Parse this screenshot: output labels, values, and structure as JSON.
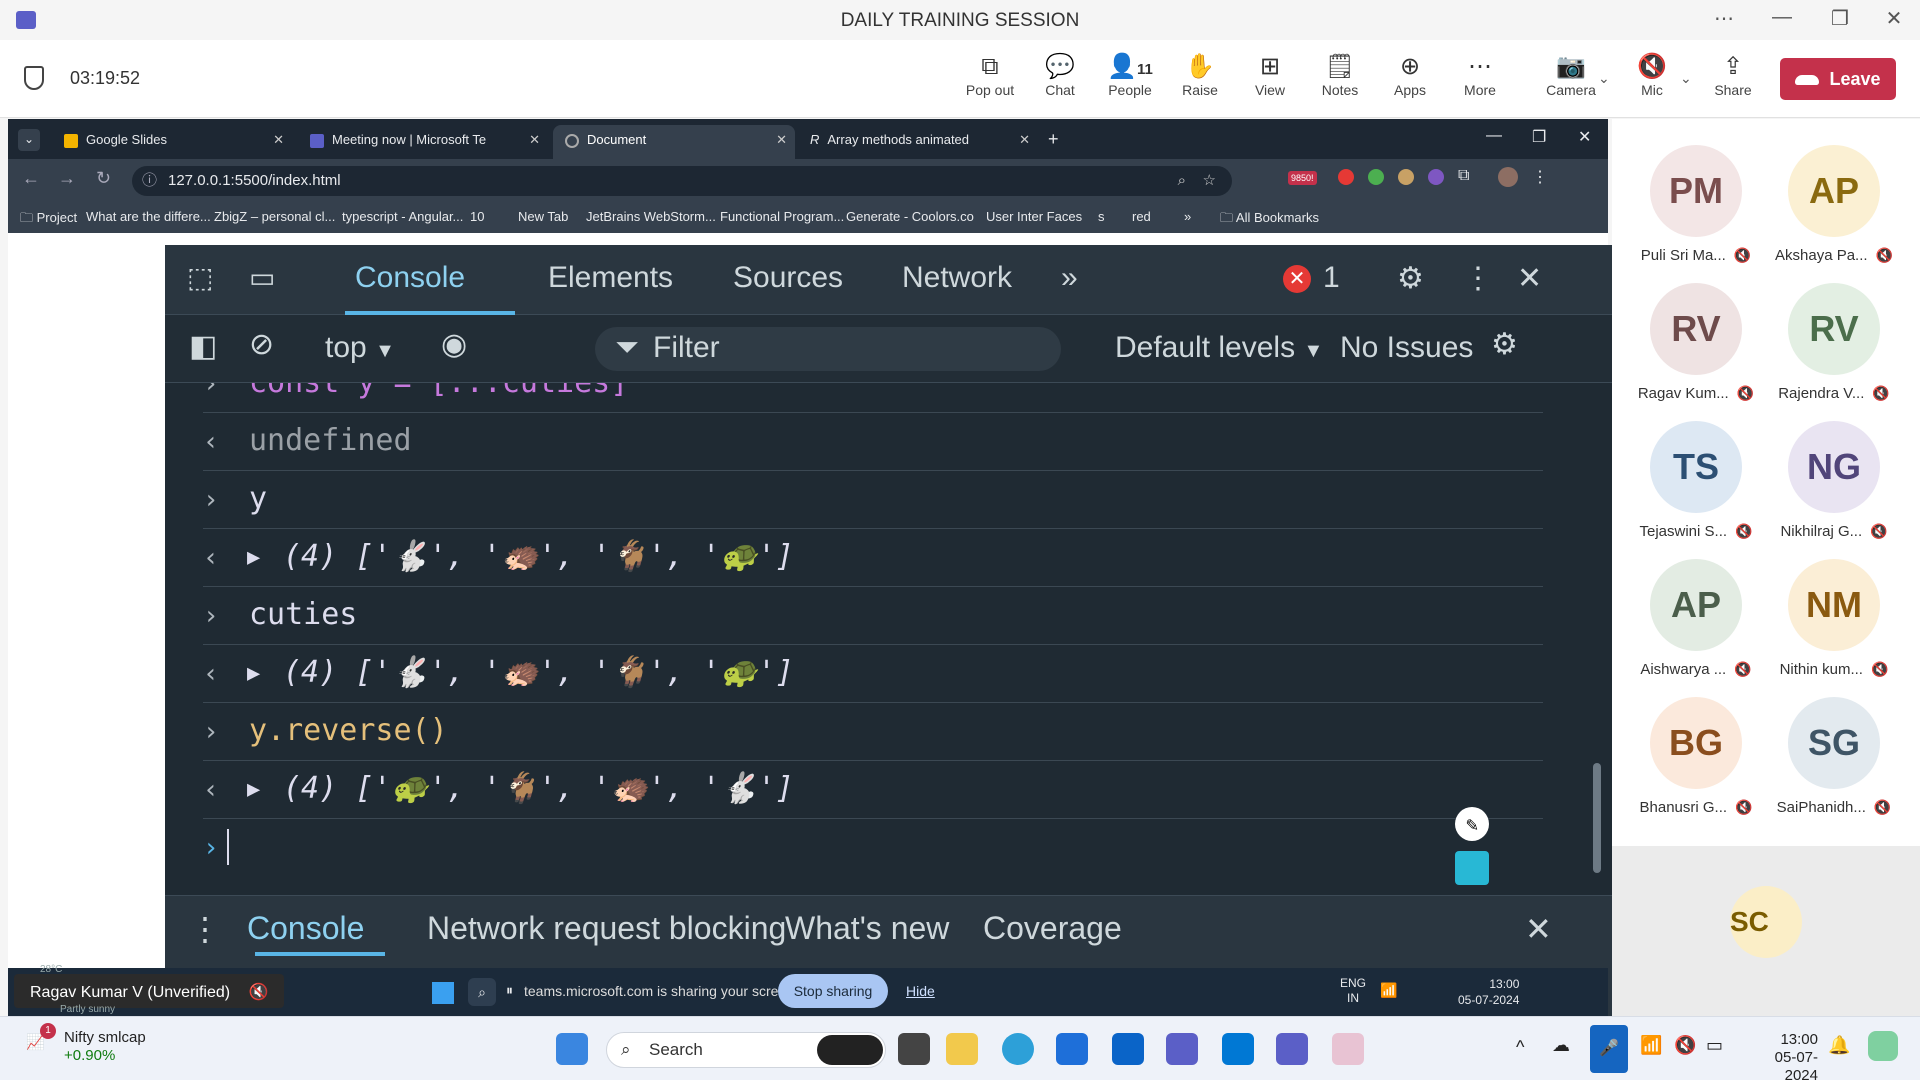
{
  "window": {
    "title": "DAILY TRAINING SESSION"
  },
  "meeting": {
    "timer": "03:19:52",
    "buttons": [
      {
        "label": "Pop out",
        "icon": "pop-out-icon"
      },
      {
        "label": "Chat",
        "icon": "chat-icon"
      },
      {
        "label": "People",
        "icon": "people-icon",
        "count": "11"
      },
      {
        "label": "Raise",
        "icon": "raise-hand-icon"
      },
      {
        "label": "View",
        "icon": "view-icon"
      },
      {
        "label": "Notes",
        "icon": "notes-icon"
      },
      {
        "label": "Apps",
        "icon": "apps-icon"
      },
      {
        "label": "More",
        "icon": "more-icon"
      },
      {
        "label": "Camera",
        "icon": "camera-off-icon"
      },
      {
        "label": "Mic",
        "icon": "mic-off-icon"
      },
      {
        "label": "Share",
        "icon": "share-icon"
      }
    ],
    "leave_label": "Leave"
  },
  "browser": {
    "tabs": [
      {
        "label": "Google Slides"
      },
      {
        "label": "Meeting now | Microsoft Te"
      },
      {
        "label": "Document"
      },
      {
        "label": "Array methods animated"
      }
    ],
    "url": "127.0.0.1:5500/index.html",
    "extension_badge": "9850!",
    "bookmarks": [
      "Project",
      "What are the differe...",
      "ZbigZ – personal cl...",
      "typescript - Angular...",
      "10",
      "New Tab",
      "JetBrains WebStorm...",
      "Functional Program...",
      "Generate - Coolors.co",
      "User Inter Faces",
      "s",
      "red",
      "All Bookmarks"
    ]
  },
  "devtools": {
    "tabs": [
      "Console",
      "Elements",
      "Sources",
      "Network"
    ],
    "error_count": "1",
    "context": "top",
    "filter_placeholder": "Filter",
    "levels": "Default levels",
    "issues": "No Issues",
    "console_lines": [
      {
        "dir": "in",
        "text": "const y = [...cuties]"
      },
      {
        "dir": "out",
        "text": "undefined"
      },
      {
        "dir": "in",
        "text": "y"
      },
      {
        "dir": "out",
        "text": "(4) ['🐇', '🦔', '🐐', '🐢']"
      },
      {
        "dir": "in",
        "text": "cuties"
      },
      {
        "dir": "out",
        "text": "(4) ['🐇', '🦔', '🐐', '🐢']"
      },
      {
        "dir": "in",
        "text": "y.reverse()"
      },
      {
        "dir": "out",
        "text": "(4) ['🐢', '🐐', '🦔', '🐇']"
      }
    ],
    "drawer_tabs": [
      "Console",
      "Network request blocking",
      "What's new",
      "Coverage"
    ]
  },
  "participants": [
    {
      "initials": "PM",
      "name": "Puli Sri Ma...",
      "bg": "#f3e6e6",
      "fg": "#7a4d4d"
    },
    {
      "initials": "AP",
      "name": "Akshaya Pa...",
      "bg": "#fbf0d3",
      "fg": "#8a6a10"
    },
    {
      "initials": "RV",
      "name": "Ragav Kum...",
      "bg": "#efe3e3",
      "fg": "#6e4b4b"
    },
    {
      "initials": "RV",
      "name": "Rajendra V...",
      "bg": "#e3efe3",
      "fg": "#4b6e4b"
    },
    {
      "initials": "TS",
      "name": "Tejaswini S...",
      "bg": "#dde8f3",
      "fg": "#2c4f73"
    },
    {
      "initials": "NG",
      "name": "Nikhilraj G...",
      "bg": "#e9e4f2",
      "fg": "#51457a"
    },
    {
      "initials": "AP",
      "name": "Aishwarya ...",
      "bg": "#e3ece3",
      "fg": "#4b5e4b"
    },
    {
      "initials": "NM",
      "name": "Nithin kum...",
      "bg": "#fbeed6",
      "fg": "#8a5a10"
    },
    {
      "initials": "BG",
      "name": "Bhanusri G...",
      "bg": "#fbe9dc",
      "fg": "#8a4e1e"
    },
    {
      "initials": "SG",
      "name": "SaiPhanidh...",
      "bg": "#e3eaef",
      "fg": "#3f5566"
    }
  ],
  "self_initials": "SC",
  "share": {
    "presenter": "Ragav Kumar V (Unverified)",
    "message": "teams.microsoft.com is sharing your screen.",
    "stop_label": "Stop sharing",
    "hide_label": "Hide",
    "lang": "ENG",
    "lang_region": "IN",
    "time": "13:00",
    "date": "05-07-2024",
    "weather_temp": "28°C",
    "weather_text": "Partly sunny"
  },
  "taskbar": {
    "widget_title": "Nifty smlcap",
    "widget_value": "+0.90%",
    "widget_badge": "1",
    "search_label": "Search",
    "time": "13:00",
    "date": "05-07-2024"
  },
  "colors": {
    "accent": "#59b5e6",
    "leave": "#c4314b",
    "devtools_bg": "#1f2a33"
  }
}
